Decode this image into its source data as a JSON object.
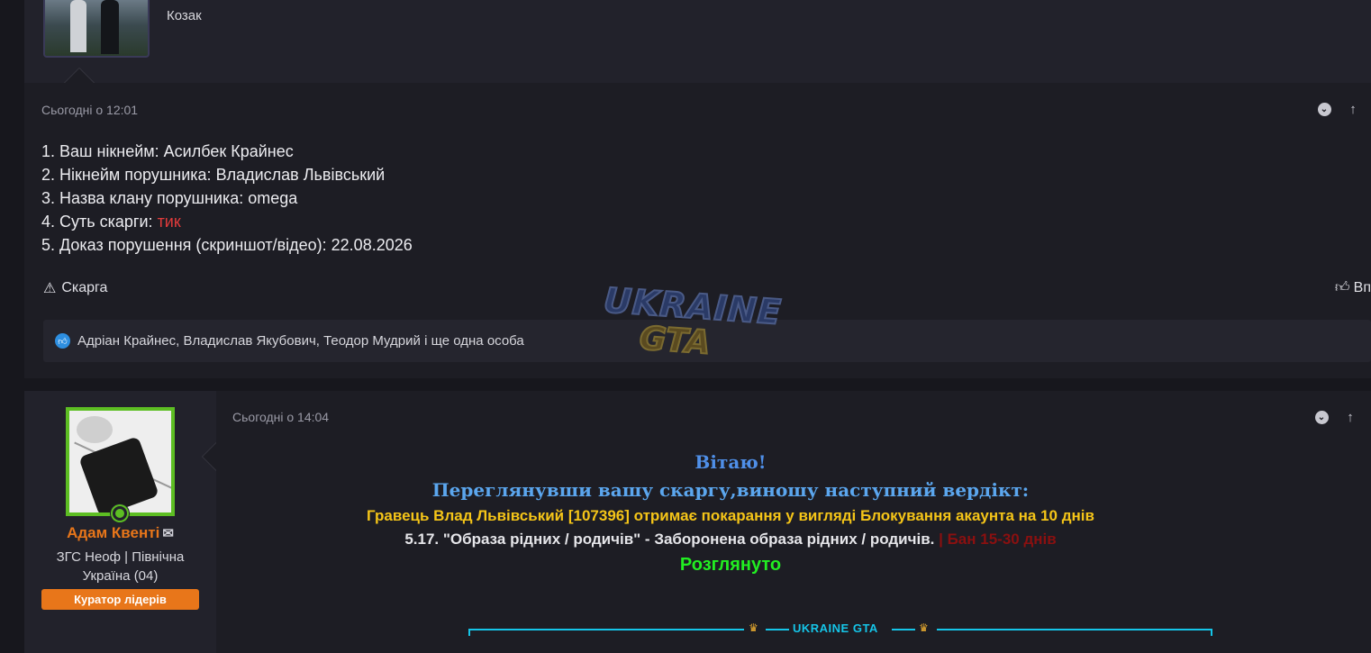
{
  "prev_post": {
    "author_title": "Козак"
  },
  "post1": {
    "date": "Сьогодні о 12:01",
    "lines": [
      {
        "label": "1. Ваш нікнейм: ",
        "value": "Асилбек Крайнес"
      },
      {
        "label": "2. Нікнейм порушника: ",
        "value": "Владислав Львівський"
      },
      {
        "label": "3. Назва клану порушника: ",
        "value": "omega"
      },
      {
        "label": "4. Суть скарги: ",
        "value": "тик",
        "value_color": "#e03b3b"
      },
      {
        "label": "5. Доказ порушення (скриншот/відео): ",
        "value": "22.08.2026"
      }
    ],
    "report_label": "Скарга",
    "like_label": "Вп",
    "reactions_text": "Адріан Крайнес, Владислав Якубович, Теодор Мудрий і ще одна особа"
  },
  "watermark": {
    "line1": "UKRAINE",
    "line2": "GTA"
  },
  "post2": {
    "author": {
      "name": "Адам Квенті",
      "title": "ЗГС Неоф | Північна Україна (04)",
      "badge": "Куратор лідерів",
      "name_color": "#e8761a",
      "badge_color": "#e8761a",
      "avatar_border": "#5dbe23"
    },
    "date": "Сьогодні о 14:04",
    "greeting": "Вітаю!",
    "reviewed": "Переглянувши вашу скаргу,виношу наступний вердікт:",
    "punishment": "Гравець Влад Львівський [107396] отримає покарання у вигляді Блокування акаунта на 10 днів",
    "rule": "5.17. \"Образа рідних / родичів\" - Заборонена образа рідних / родичів.",
    "ban_range": " | Бан 15-30 днів",
    "status": "Розглянуто",
    "footer_brand": "UKRAINE GTA"
  },
  "icons": {
    "bookmark": "chevron-down-circle-icon",
    "share": "arrow-up-icon",
    "warning": "warning-triangle-icon",
    "like": "thumbs-up-icon",
    "mail": "envelope-icon",
    "crown": "crown-icon"
  }
}
